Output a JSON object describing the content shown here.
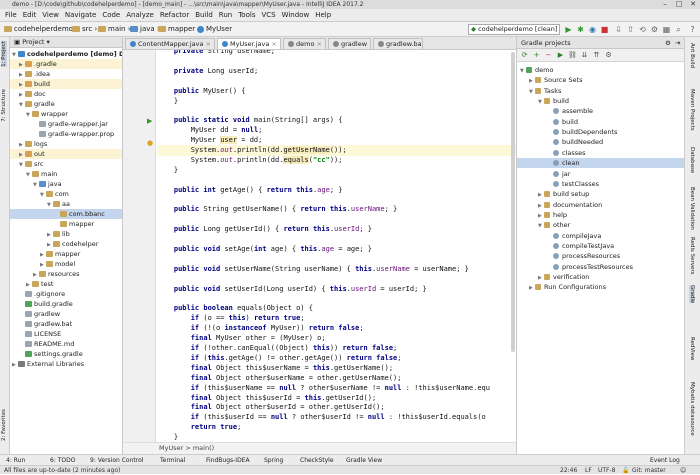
{
  "window": {
    "title": "demo - [D:\\code\\github\\codehelperdemo] - [demo_main] - ...\\src\\main\\java\\mapper\\MyUser.java - IntelliJ IDEA 2017.2"
  },
  "menu": [
    "File",
    "Edit",
    "View",
    "Navigate",
    "Code",
    "Analyze",
    "Refactor",
    "Build",
    "Run",
    "Tools",
    "VCS",
    "Window",
    "Help"
  ],
  "breadcrumbs": [
    "codehelperdemo",
    "src",
    "main",
    "java",
    "mapper",
    "MyUser"
  ],
  "run_config": "codehelperdemo [clean]",
  "editor_tabs": [
    {
      "label": "ContentMapper.java",
      "active": false
    },
    {
      "label": "MyUser.java",
      "active": true
    },
    {
      "label": "demo",
      "active": false
    },
    {
      "label": "gradlew",
      "active": false
    },
    {
      "label": "gradlew.bat",
      "active": false
    }
  ],
  "project_panel": {
    "title": "Project",
    "items": [
      {
        "label": "codehelperdemo [demo]  D:\\co",
        "depth": 0,
        "open": true,
        "type": "module",
        "selected": false
      },
      {
        "label": ".gradle",
        "depth": 1,
        "open": false,
        "type": "folder-ex",
        "selected": false
      },
      {
        "label": ".idea",
        "depth": 1,
        "open": false,
        "type": "folder",
        "selected": false
      },
      {
        "label": "build",
        "depth": 1,
        "open": false,
        "type": "folder-ex",
        "selected": false
      },
      {
        "label": "doc",
        "depth": 1,
        "open": false,
        "type": "folder",
        "selected": false
      },
      {
        "label": "gradle",
        "depth": 1,
        "open": true,
        "type": "folder",
        "selected": false
      },
      {
        "label": "wrapper",
        "depth": 2,
        "open": true,
        "type": "folder",
        "selected": false
      },
      {
        "label": "gradle-wrapper.jar",
        "depth": 3,
        "open": null,
        "type": "file",
        "selected": false
      },
      {
        "label": "gradle-wrapper.prop",
        "depth": 3,
        "open": null,
        "type": "file",
        "selected": false
      },
      {
        "label": "logs",
        "depth": 1,
        "open": false,
        "type": "folder",
        "selected": false
      },
      {
        "label": "out",
        "depth": 1,
        "open": false,
        "type": "folder-ex",
        "selected": false
      },
      {
        "label": "src",
        "depth": 1,
        "open": true,
        "type": "folder",
        "selected": false
      },
      {
        "label": "main",
        "depth": 2,
        "open": true,
        "type": "folder",
        "selected": false
      },
      {
        "label": "java",
        "depth": 3,
        "open": true,
        "type": "folder-src",
        "selected": false
      },
      {
        "label": "com",
        "depth": 4,
        "open": true,
        "type": "folder",
        "selected": false
      },
      {
        "label": "aa",
        "depth": 5,
        "open": true,
        "type": "folder",
        "selected": false
      },
      {
        "label": "com.bbanc",
        "depth": 6,
        "open": null,
        "type": "folder",
        "selected": true
      },
      {
        "label": "mapper",
        "depth": 6,
        "open": null,
        "type": "folder",
        "selected": false
      },
      {
        "label": "lib",
        "depth": 5,
        "open": false,
        "type": "folder",
        "selected": false
      },
      {
        "label": "codehelper",
        "depth": 5,
        "open": false,
        "type": "folder",
        "selected": false
      },
      {
        "label": "mapper",
        "depth": 4,
        "open": false,
        "type": "folder",
        "selected": false
      },
      {
        "label": "model",
        "depth": 4,
        "open": false,
        "type": "folder",
        "selected": false
      },
      {
        "label": "resources",
        "depth": 3,
        "open": false,
        "type": "folder",
        "selected": false
      },
      {
        "label": "test",
        "depth": 2,
        "open": false,
        "type": "folder",
        "selected": false
      },
      {
        "label": ".gitignore",
        "depth": 1,
        "open": null,
        "type": "file",
        "selected": false
      },
      {
        "label": "build.gradle",
        "depth": 1,
        "open": null,
        "type": "file-gradle",
        "selected": false
      },
      {
        "label": "gradlew",
        "depth": 1,
        "open": null,
        "type": "file",
        "selected": false
      },
      {
        "label": "gradlew.bat",
        "depth": 1,
        "open": null,
        "type": "file",
        "selected": false
      },
      {
        "label": "LICENSE",
        "depth": 1,
        "open": null,
        "type": "file",
        "selected": false
      },
      {
        "label": "README.md",
        "depth": 1,
        "open": null,
        "type": "file",
        "selected": false
      },
      {
        "label": "settings.gradle",
        "depth": 1,
        "open": null,
        "type": "file-gradle",
        "selected": false
      },
      {
        "label": "External Libraries",
        "depth": 0,
        "open": false,
        "type": "lib",
        "selected": false
      }
    ]
  },
  "code_lines": [
    {
      "html": "    <span class=\"kw\">private</span> String userName;"
    },
    {
      "html": ""
    },
    {
      "html": "    <span class=\"kw\">private</span> Long userId;"
    },
    {
      "html": ""
    },
    {
      "html": "    <span class=\"kw\">public</span> MyUser() {"
    },
    {
      "html": "    }"
    },
    {
      "html": ""
    },
    {
      "html": "    <span class=\"kw\">public static void</span> main(String[] args) {"
    },
    {
      "html": "        MyUser dd = <span class=\"kw\">null</span>;"
    },
    {
      "html": "        MyUser <span class=\"warnhl\">user</span> = dd;"
    },
    {
      "html": "        System.<span class=\"st\">out</span>.println(dd.<span class=\"warnhl\">getUserName</span>());",
      "hl": true
    },
    {
      "html": "        System.<span class=\"st\">out</span>.println(dd.<span class=\"warnhl\">equals</span>(<span class=\"str\">\"cc\"</span>));"
    },
    {
      "html": "    }"
    },
    {
      "html": ""
    },
    {
      "html": "    <span class=\"kw\">public int</span> getAge() { <span class=\"kw\">return this</span>.<span class=\"fld\">age</span>; }"
    },
    {
      "html": ""
    },
    {
      "html": "    <span class=\"kw\">public</span> String getUserName() { <span class=\"kw\">return this</span>.<span class=\"fld\">userName</span>; }"
    },
    {
      "html": ""
    },
    {
      "html": "    <span class=\"kw\">public</span> Long getUserId() { <span class=\"kw\">return this</span>.<span class=\"fld\">userId</span>; }"
    },
    {
      "html": ""
    },
    {
      "html": "    <span class=\"kw\">public void</span> setAge(<span class=\"kw\">int</span> age) { <span class=\"kw\">this</span>.<span class=\"fld\">age</span> = age; }"
    },
    {
      "html": ""
    },
    {
      "html": "    <span class=\"kw\">public void</span> setUserName(String userName) { <span class=\"kw\">this</span>.<span class=\"fld\">userName</span> = userName; }"
    },
    {
      "html": ""
    },
    {
      "html": "    <span class=\"kw\">public void</span> setUserId(Long userId) { <span class=\"kw\">this</span>.<span class=\"fld\">userId</span> = userId; }"
    },
    {
      "html": ""
    },
    {
      "html": "    <span class=\"kw\">public boolean</span> equals(Object o) {"
    },
    {
      "html": "        <span class=\"kw\">if</span> (o == <span class=\"kw\">this</span>) <span class=\"kw\">return true</span>;"
    },
    {
      "html": "        <span class=\"kw\">if</span> (!(o <span class=\"kw\">instanceof</span> MyUser)) <span class=\"kw\">return false</span>;"
    },
    {
      "html": "        <span class=\"kw\">final</span> MyUser other = (MyUser) o;"
    },
    {
      "html": "        <span class=\"kw\">if</span> (!other.canEqual((Object) <span class=\"kw\">this</span>)) <span class=\"kw\">return false</span>;"
    },
    {
      "html": "        <span class=\"kw\">if</span> (<span class=\"kw\">this</span>.getAge() != other.getAge()) <span class=\"kw\">return false</span>;"
    },
    {
      "html": "        <span class=\"kw\">final</span> Object this$userName = <span class=\"kw\">this</span>.getUserName();"
    },
    {
      "html": "        <span class=\"kw\">final</span> Object other$userName = other.getUserName();"
    },
    {
      "html": "        <span class=\"kw\">if</span> (this$userName == <span class=\"kw\">null</span> ? other$userName != <span class=\"kw\">null</span> : !this$userName.equ"
    },
    {
      "html": "        <span class=\"kw\">final</span> Object this$userId = <span class=\"kw\">this</span>.getUserId();"
    },
    {
      "html": "        <span class=\"kw\">final</span> Object other$userId = other.getUserId();"
    },
    {
      "html": "        <span class=\"kw\">if</span> (this$userId == <span class=\"kw\">null</span> ? other$userId != <span class=\"kw\">null</span> : !this$userId.equals(o"
    },
    {
      "html": "        <span class=\"kw\">return true</span>;"
    },
    {
      "html": "    }"
    }
  ],
  "editor_breadcrumb": "MyUser  >  main()",
  "gradle_panel": {
    "title": "Gradle projects",
    "items": [
      {
        "label": "demo",
        "depth": 0,
        "open": true,
        "kind": "project",
        "selected": false
      },
      {
        "label": "Source Sets",
        "depth": 1,
        "open": false,
        "kind": "folder",
        "selected": false
      },
      {
        "label": "Tasks",
        "depth": 1,
        "open": true,
        "kind": "folder",
        "selected": false
      },
      {
        "label": "build",
        "depth": 2,
        "open": true,
        "kind": "folder",
        "selected": false
      },
      {
        "label": "assemble",
        "depth": 3,
        "open": null,
        "kind": "task",
        "selected": false
      },
      {
        "label": "build",
        "depth": 3,
        "open": null,
        "kind": "task",
        "selected": false
      },
      {
        "label": "buildDependents",
        "depth": 3,
        "open": null,
        "kind": "task",
        "selected": false
      },
      {
        "label": "buildNeeded",
        "depth": 3,
        "open": null,
        "kind": "task",
        "selected": false
      },
      {
        "label": "classes",
        "depth": 3,
        "open": null,
        "kind": "task",
        "selected": false
      },
      {
        "label": "clean",
        "depth": 3,
        "open": null,
        "kind": "task",
        "selected": true
      },
      {
        "label": "jar",
        "depth": 3,
        "open": null,
        "kind": "task",
        "selected": false
      },
      {
        "label": "testClasses",
        "depth": 3,
        "open": null,
        "kind": "task",
        "selected": false
      },
      {
        "label": "build setup",
        "depth": 2,
        "open": false,
        "kind": "folder",
        "selected": false
      },
      {
        "label": "documentation",
        "depth": 2,
        "open": false,
        "kind": "folder",
        "selected": false
      },
      {
        "label": "help",
        "depth": 2,
        "open": false,
        "kind": "folder",
        "selected": false
      },
      {
        "label": "other",
        "depth": 2,
        "open": true,
        "kind": "folder",
        "selected": false
      },
      {
        "label": "compileJava",
        "depth": 3,
        "open": null,
        "kind": "task",
        "selected": false
      },
      {
        "label": "compileTestJava",
        "depth": 3,
        "open": null,
        "kind": "task",
        "selected": false
      },
      {
        "label": "processResources",
        "depth": 3,
        "open": null,
        "kind": "task",
        "selected": false
      },
      {
        "label": "processTestResources",
        "depth": 3,
        "open": null,
        "kind": "task",
        "selected": false
      },
      {
        "label": "verification",
        "depth": 2,
        "open": false,
        "kind": "folder",
        "selected": false
      },
      {
        "label": "Run Configurations",
        "depth": 1,
        "open": false,
        "kind": "folder",
        "selected": false
      }
    ]
  },
  "left_strip": [
    "1: Project",
    "7: Structure",
    "2: Favorites"
  ],
  "right_strip": [
    "Ant Build",
    "Maven Projects",
    "Database",
    "Bean Validation",
    "Redis Servers",
    "Gradle",
    "RedView",
    "Mybatis datasource"
  ],
  "bottom_tools": [
    "4: Run",
    "6: TODO",
    "9: Version Control",
    "Terminal",
    "FindBugs-IDEA",
    "Spring",
    "CheckStyle",
    "Gradle View",
    "Event Log"
  ],
  "status": {
    "message": "All files are up-to-date (2 minutes ago)",
    "position": "22:46",
    "line_sep": "LF",
    "encoding": "UTF-8",
    "vcs": "Git: master"
  }
}
